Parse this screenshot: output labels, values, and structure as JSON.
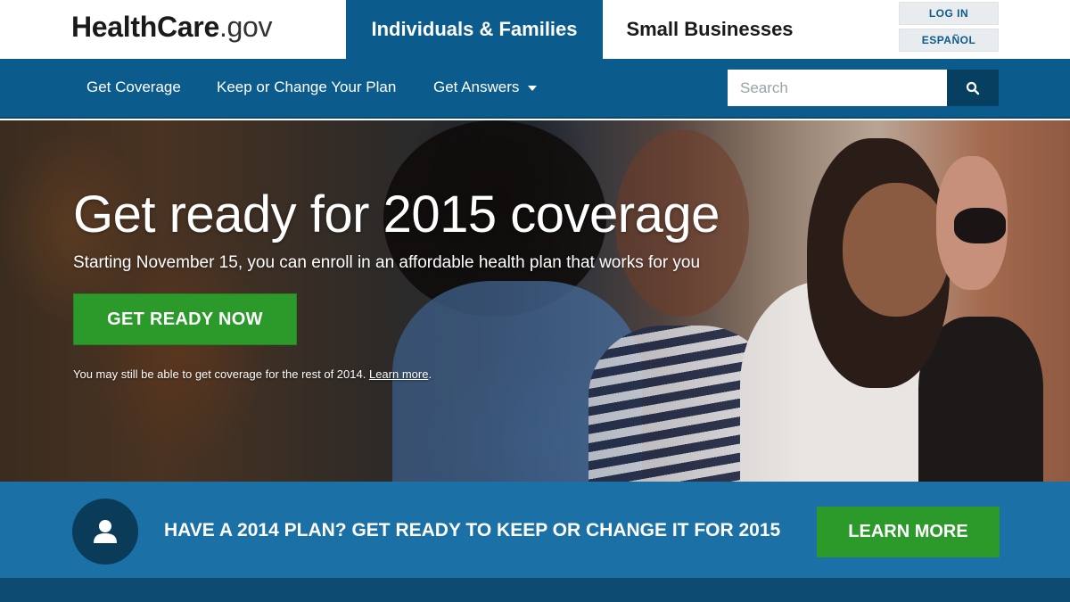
{
  "header": {
    "logo_main": "HealthCare",
    "logo_tld": ".gov",
    "tabs": [
      {
        "label": "Individuals & Families",
        "active": true
      },
      {
        "label": "Small Businesses",
        "active": false
      }
    ],
    "utility": {
      "login_label": "LOG IN",
      "espanol_label": "ESPAÑOL"
    }
  },
  "nav": {
    "items": [
      {
        "label": "Get Coverage"
      },
      {
        "label": "Keep or Change Your Plan"
      },
      {
        "label": "Get Answers",
        "has_dropdown": true
      }
    ],
    "search": {
      "placeholder": "Search",
      "value": ""
    }
  },
  "hero": {
    "title": "Get ready for 2015 coverage",
    "subtitle": "Starting November 15, you can enroll in an affordable health plan that works for you",
    "cta_label": "GET READY NOW",
    "note_text": "You may still be able to get coverage for the rest of 2014.",
    "note_link": "Learn more",
    "note_end": "."
  },
  "banner": {
    "text": "HAVE A 2014 PLAN? GET READY TO KEEP OR CHANGE IT FOR 2015",
    "button_label": "LEARN MORE"
  },
  "colors": {
    "primary_blue": "#0b5c8c",
    "banner_blue": "#1b70a6",
    "cta_green": "#2b9a2b"
  }
}
